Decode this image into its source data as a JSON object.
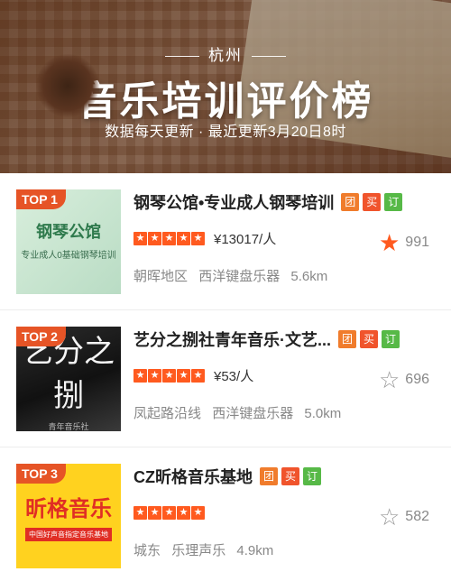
{
  "header": {
    "city": "杭州",
    "title": "音乐培训评价榜",
    "subtitle": "数据每天更新 · 最近更新3月20日8时"
  },
  "items": [
    {
      "rank_label": "TOP 1",
      "thumb_main": "钢琴公馆",
      "thumb_sub": "专业成人0基础钢琴培训",
      "name": "钢琴公馆•专业成人钢琴培训",
      "tags": [
        "团",
        "买",
        "订"
      ],
      "price": "¥13017/人",
      "favorited": true,
      "fav_count": "991",
      "area": "朝晖地区",
      "category": "西洋键盘乐器",
      "distance": "5.6km"
    },
    {
      "rank_label": "TOP 2",
      "thumb_main": "艺分之捌",
      "thumb_sub": "青年音乐社",
      "name": "艺分之捌社青年音乐·文艺...",
      "tags": [
        "团",
        "买",
        "订"
      ],
      "price": "¥53/人",
      "favorited": false,
      "fav_count": "696",
      "area": "凤起路沿线",
      "category": "西洋键盘乐器",
      "distance": "5.0km"
    },
    {
      "rank_label": "TOP 3",
      "thumb_main": "昕格音乐",
      "thumb_sub": "中国好声音指定音乐基地",
      "name": "CZ昕格音乐基地",
      "tags": [
        "团",
        "买",
        "订"
      ],
      "price": "",
      "favorited": false,
      "fav_count": "582",
      "area": "城东",
      "category": "乐理声乐",
      "distance": "4.9km"
    }
  ],
  "icons": {
    "star_rating": "star-rating-icon",
    "favorite": "star-favorite-icon"
  },
  "colors": {
    "accent": "#ff5a1f",
    "top_badge": "#e65426",
    "tag_tuan": "#f07c2c",
    "tag_mai": "#f0542c",
    "tag_ding": "#57b947"
  }
}
